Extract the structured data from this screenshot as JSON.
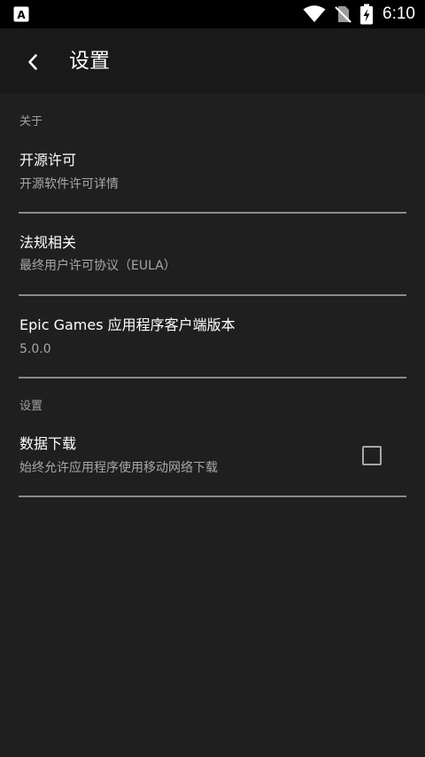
{
  "status_bar": {
    "left_icon": "accessibility-a-icon",
    "icons": [
      "wifi-icon",
      "no-sim-icon",
      "battery-charging-icon"
    ],
    "time": "6:10"
  },
  "app_bar": {
    "back_icon": "chevron-left-icon",
    "title": "设置"
  },
  "sections": [
    {
      "label": "关于",
      "items": [
        {
          "title": "开源许可",
          "subtitle": "开源软件许可详情"
        },
        {
          "title": "法规相关",
          "subtitle": "最终用户许可协议（EULA）"
        },
        {
          "title": "Epic Games 应用程序客户端版本",
          "subtitle": "5.0.0"
        }
      ]
    },
    {
      "label": "设置",
      "items": [
        {
          "title": "数据下载",
          "subtitle": "始终允许应用程序使用移动网络下载",
          "checkbox_checked": false
        }
      ]
    }
  ],
  "colors": {
    "background": "#1f1f1f",
    "app_bar": "#191919",
    "status_bar": "#000000",
    "primary_text": "#ffffff",
    "secondary_text": "#a8a8a8",
    "divider": "#8a8a8a"
  }
}
